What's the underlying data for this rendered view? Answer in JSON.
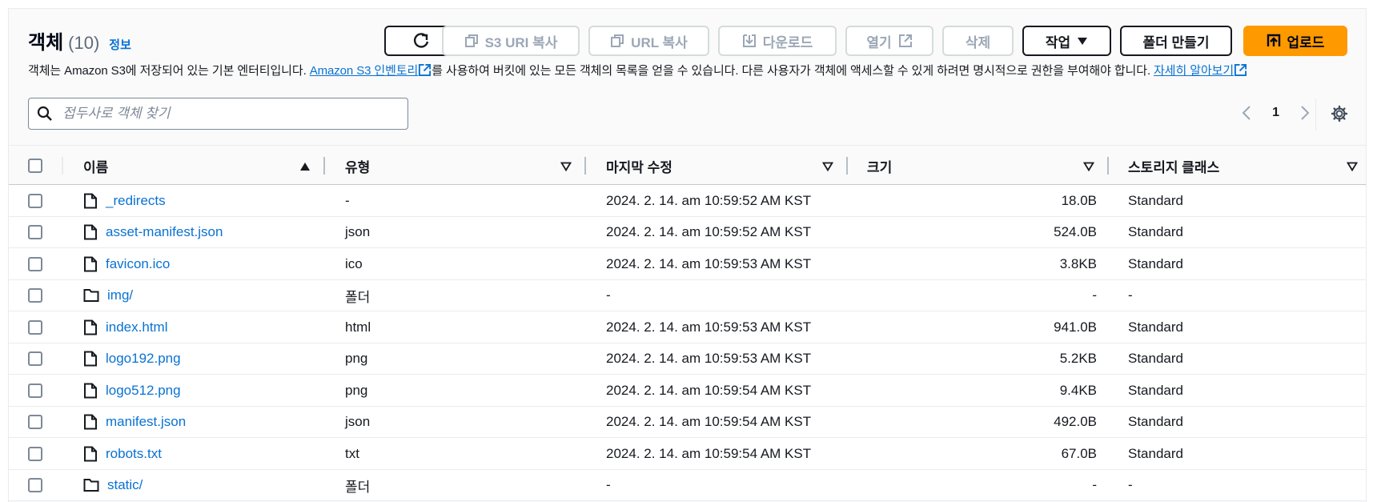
{
  "header": {
    "title": "객체",
    "count": "(10)",
    "info_link": "정보",
    "description_1": "객체는 Amazon S3에 저장되어 있는 기본 엔터티입니다. ",
    "inventory_link": "Amazon S3 인벤토리",
    "description_2": "를 사용하여 버킷에 있는 모든 객체의 목록을 얻을 수 있습니다. 다른 사용자가 객체에 액세스할 수 있게 하려면 명시적으로 권한을 부여해야 합니다. ",
    "learn_more_link": "자세히 알아보기"
  },
  "toolbar": {
    "refresh_icon": "refresh-icon",
    "copy_s3_uri": "S3 URI 복사",
    "copy_url": "URL 복사",
    "download": "다운로드",
    "open": "열기",
    "delete": "삭제",
    "actions": "작업",
    "create_folder": "폴더 만들기",
    "upload": "업로드"
  },
  "search": {
    "placeholder": "접두사로 객체 찾기"
  },
  "pagination": {
    "current_page": "1"
  },
  "table": {
    "columns": {
      "name": "이름",
      "type": "유형",
      "last_modified": "마지막 수정",
      "size": "크기",
      "storage_class": "스토리지 클래스"
    },
    "rows": [
      {
        "name": "_redirects",
        "kind": "file",
        "type": "-",
        "last_modified": "2024. 2. 14. am 10:59:52 AM KST",
        "size": "18.0B",
        "storage_class": "Standard"
      },
      {
        "name": "asset-manifest.json",
        "kind": "file",
        "type": "json",
        "last_modified": "2024. 2. 14. am 10:59:52 AM KST",
        "size": "524.0B",
        "storage_class": "Standard"
      },
      {
        "name": "favicon.ico",
        "kind": "file",
        "type": "ico",
        "last_modified": "2024. 2. 14. am 10:59:53 AM KST",
        "size": "3.8KB",
        "storage_class": "Standard"
      },
      {
        "name": "img/",
        "kind": "folder",
        "type": "폴더",
        "last_modified": "-",
        "size": "-",
        "storage_class": "-"
      },
      {
        "name": "index.html",
        "kind": "file",
        "type": "html",
        "last_modified": "2024. 2. 14. am 10:59:53 AM KST",
        "size": "941.0B",
        "storage_class": "Standard"
      },
      {
        "name": "logo192.png",
        "kind": "file",
        "type": "png",
        "last_modified": "2024. 2. 14. am 10:59:53 AM KST",
        "size": "5.2KB",
        "storage_class": "Standard"
      },
      {
        "name": "logo512.png",
        "kind": "file",
        "type": "png",
        "last_modified": "2024. 2. 14. am 10:59:54 AM KST",
        "size": "9.4KB",
        "storage_class": "Standard"
      },
      {
        "name": "manifest.json",
        "kind": "file",
        "type": "json",
        "last_modified": "2024. 2. 14. am 10:59:54 AM KST",
        "size": "492.0B",
        "storage_class": "Standard"
      },
      {
        "name": "robots.txt",
        "kind": "file",
        "type": "txt",
        "last_modified": "2024. 2. 14. am 10:59:54 AM KST",
        "size": "67.0B",
        "storage_class": "Standard"
      },
      {
        "name": "static/",
        "kind": "folder",
        "type": "폴더",
        "last_modified": "-",
        "size": "-",
        "storage_class": "-"
      }
    ]
  },
  "colors": {
    "link": "#0972d3",
    "primary": "#ff9900",
    "disabled": "#9ba7b6"
  }
}
